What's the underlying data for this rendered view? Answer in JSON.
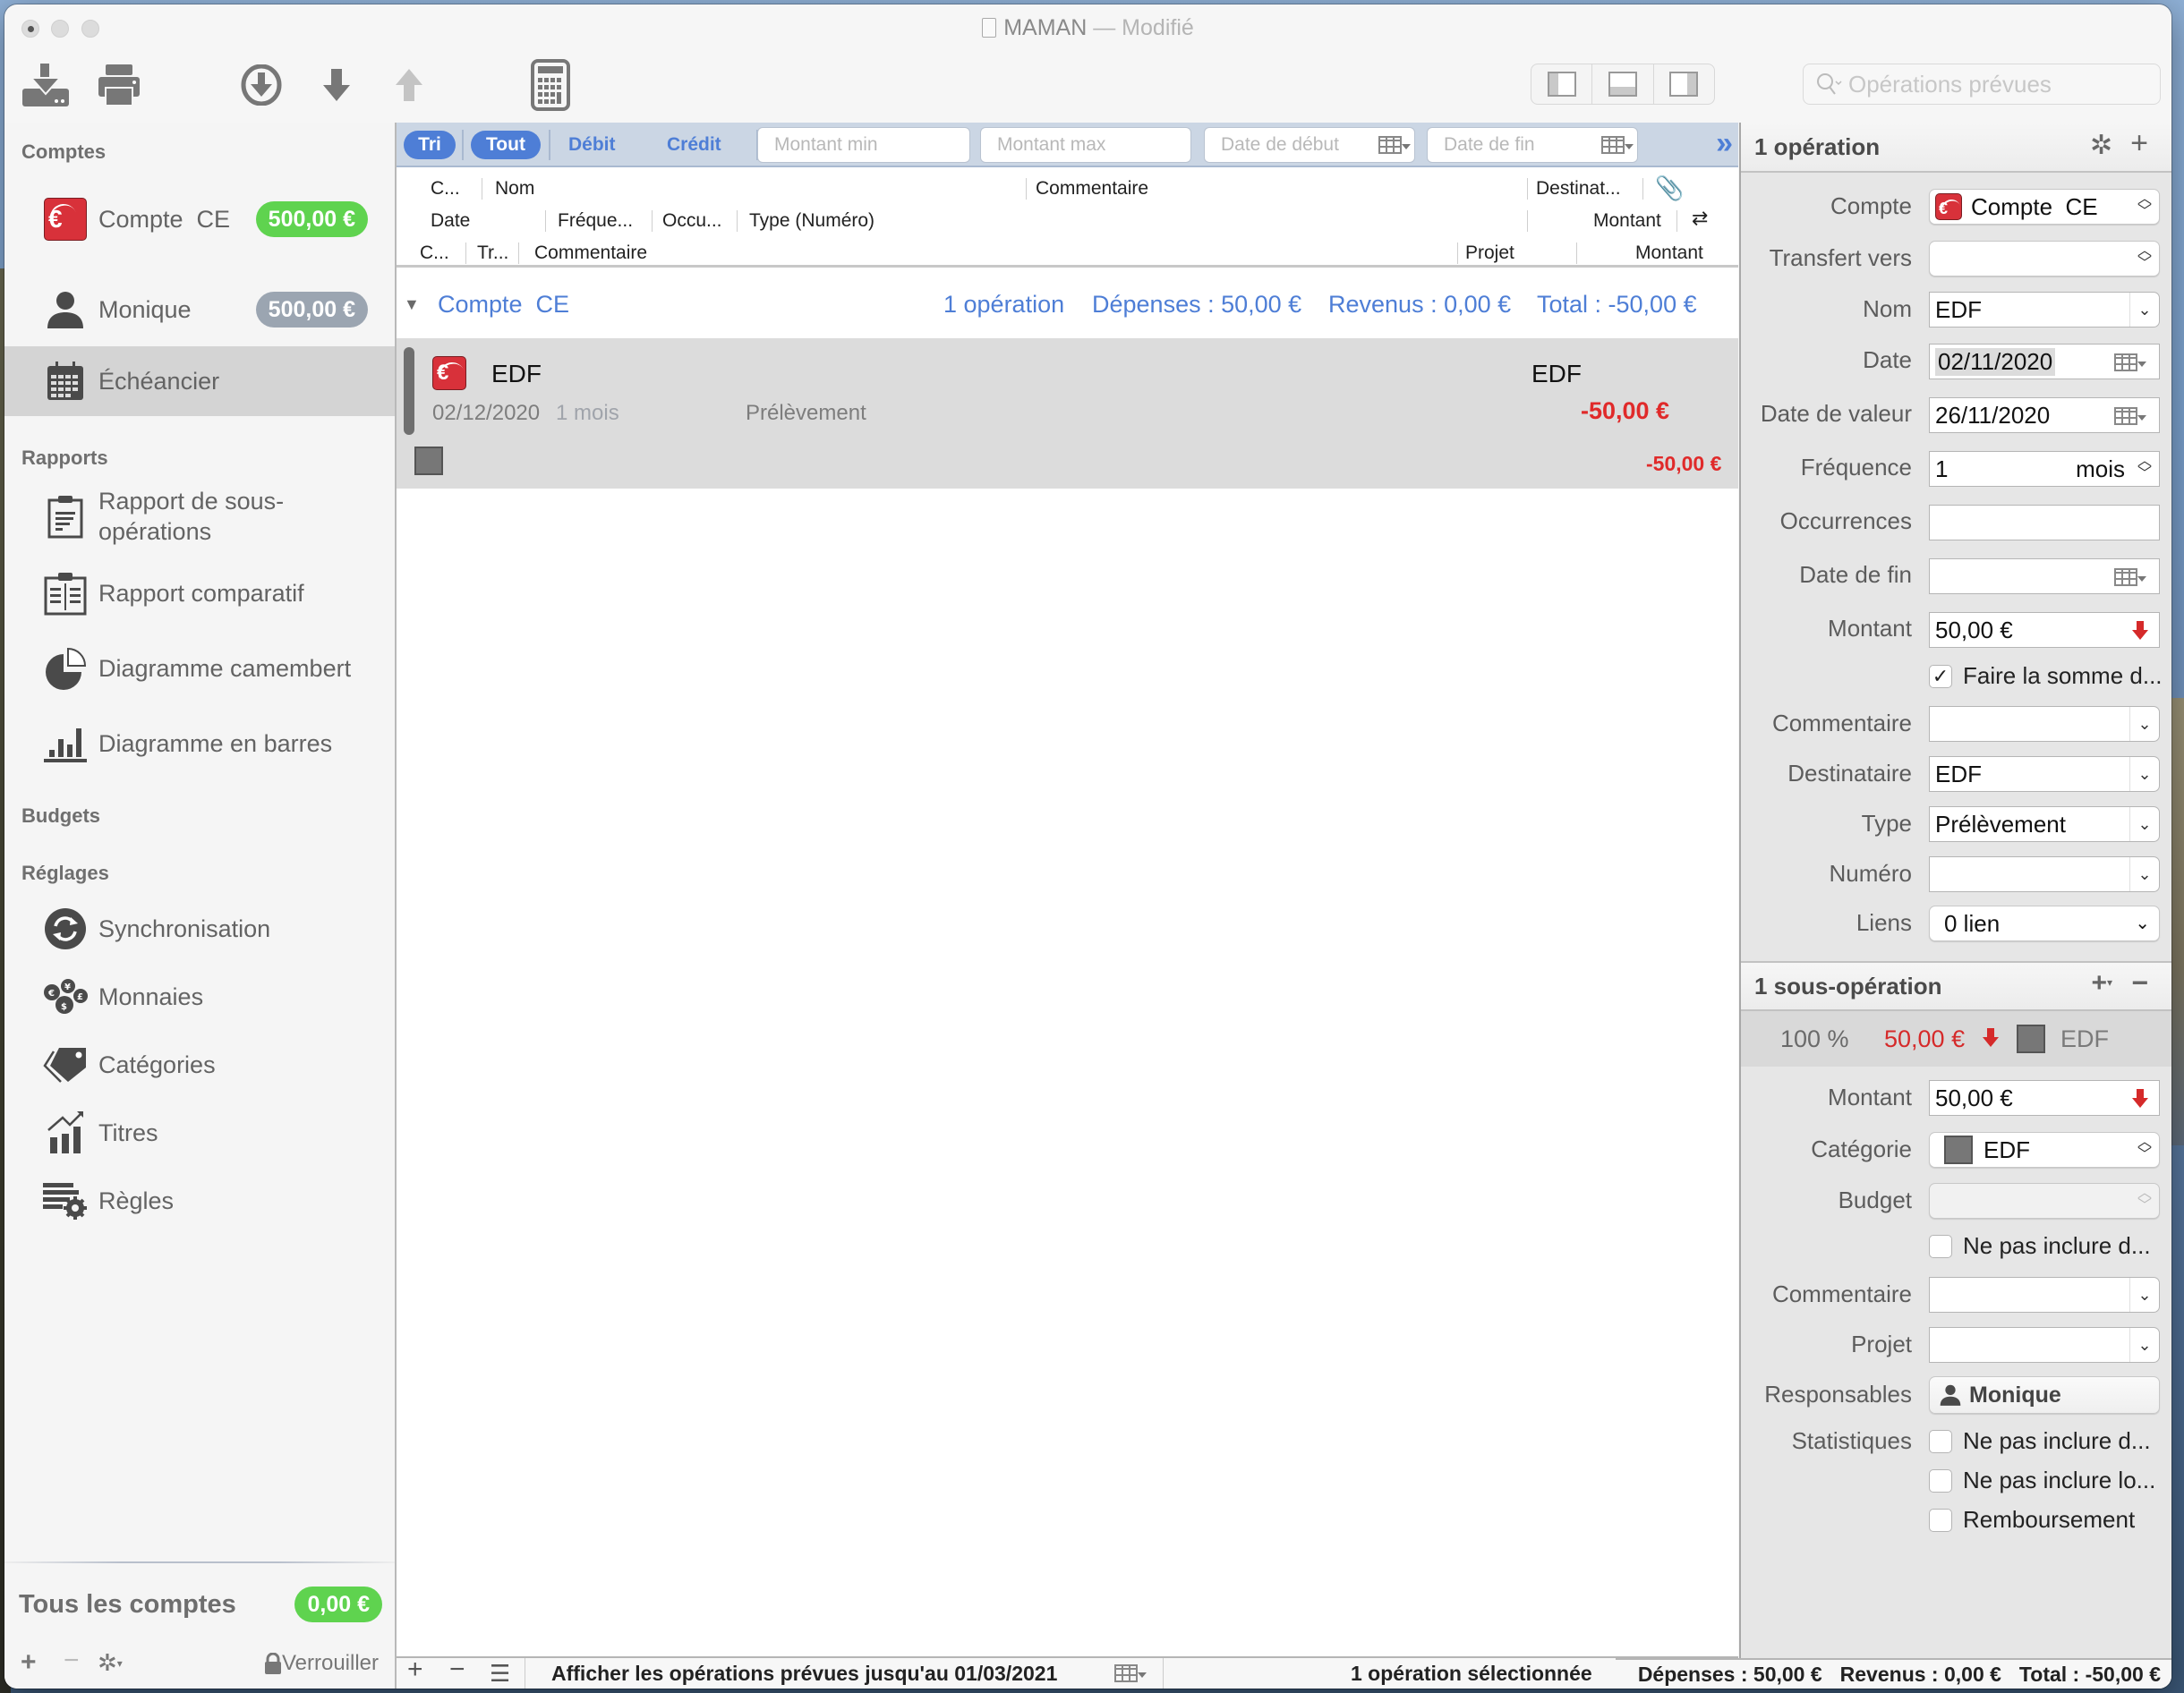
{
  "window": {
    "title": "MAMAN",
    "title_suffix": "— Modifié"
  },
  "toolbar": {
    "buttons": [
      {
        "name": "import-icon"
      },
      {
        "name": "print-icon"
      },
      {
        "name": "download-circle-icon"
      },
      {
        "name": "arrow-down-icon"
      },
      {
        "name": "arrow-up-icon"
      },
      {
        "name": "calculator-icon"
      }
    ],
    "view_toggles": [
      "sidebar-left-icon",
      "panel-bottom-icon",
      "sidebar-right-icon"
    ],
    "search_placeholder": "Opérations prévues"
  },
  "sidebar": {
    "sections": {
      "comptes": "Comptes",
      "rapports": "Rapports",
      "budgets": "Budgets",
      "reglages": "Réglages"
    },
    "accounts": [
      {
        "label": "Compte  CE",
        "balance": "500,00 €",
        "badge_color": "#5fd34f",
        "icon": "bank-icon"
      },
      {
        "label": "Monique",
        "balance": "500,00 €",
        "badge_color": "#9ba5b1",
        "icon": "person-icon"
      }
    ],
    "echeancier": "Échéancier",
    "reports": [
      {
        "label": "Rapport de sous-opérations",
        "icon": "clipboard-report-icon"
      },
      {
        "label": "Rapport comparatif",
        "icon": "clipboard-compare-icon"
      },
      {
        "label": "Diagramme camembert",
        "icon": "pie-chart-icon"
      },
      {
        "label": "Diagramme en barres",
        "icon": "bar-chart-icon"
      }
    ],
    "settings": [
      {
        "label": "Synchronisation",
        "icon": "sync-icon"
      },
      {
        "label": "Monnaies",
        "icon": "currencies-icon"
      },
      {
        "label": "Catégories",
        "icon": "tag-icon"
      },
      {
        "label": "Titres",
        "icon": "stocks-icon"
      },
      {
        "label": "Règles",
        "icon": "rules-icon"
      }
    ],
    "all_accounts_label": "Tous les comptes",
    "all_accounts_balance": "0,00 €",
    "lock_label": "Verrouiller"
  },
  "filter": {
    "tri": "Tri",
    "tout": "Tout",
    "debit": "Débit",
    "credit": "Crédit",
    "montant_min_placeholder": "Montant min",
    "montant_max_placeholder": "Montant max",
    "date_debut_placeholder": "Date de début",
    "date_fin_placeholder": "Date de fin"
  },
  "columns": {
    "row1": {
      "c": "C...",
      "nom": "Nom",
      "commentaire": "Commentaire",
      "destinataire": "Destinat..."
    },
    "row2": {
      "date": "Date",
      "frequence": "Fréque...",
      "occurrences": "Occu...",
      "type": "Type (Numéro)",
      "montant": "Montant"
    },
    "row3": {
      "c": "C...",
      "tr": "Tr...",
      "commentaire": "Commentaire",
      "projet": "Projet",
      "montant": "Montant"
    }
  },
  "group": {
    "name": "Compte  CE",
    "count": "1 opération",
    "depenses": "Dépenses : 50,00 €",
    "revenus": "Revenus : 0,00 €",
    "total": "Total : -50,00 €"
  },
  "operations": [
    {
      "nom": "EDF",
      "destinataire": "EDF",
      "date": "02/12/2020",
      "frequence": "1 mois",
      "type": "Prélèvement",
      "montant": "-50,00 €",
      "sub_montant": "-50,00 €"
    }
  ],
  "footer": {
    "show_until": "Afficher les opérations prévues jusqu'au 01/03/2021",
    "selection": "1 opération sélectionnée",
    "depenses": "Dépenses : 50,00 €",
    "revenus": "Revenus : 0,00 €",
    "total": "Total : -50,00 €"
  },
  "inspector": {
    "header": "1 opération",
    "fields": {
      "compte_label": "Compte",
      "compte_value": "Compte  CE",
      "transfert_label": "Transfert vers",
      "transfert_value": "",
      "nom_label": "Nom",
      "nom_value": "EDF",
      "date_label": "Date",
      "date_value": "02/11/2020",
      "date_valeur_label": "Date de valeur",
      "date_valeur_value": "26/11/2020",
      "frequence_label": "Fréquence",
      "frequence_value": "1",
      "frequence_unit": "mois",
      "occurrences_label": "Occurrences",
      "occurrences_value": "",
      "date_fin_label": "Date de fin",
      "date_fin_value": "",
      "montant_label": "Montant",
      "montant_value": "50,00 €",
      "somme_checkbox": "Faire la somme d...",
      "somme_checked": true,
      "commentaire_label": "Commentaire",
      "commentaire_value": "",
      "destinataire_label": "Destinataire",
      "destinataire_value": "EDF",
      "type_label": "Type",
      "type_value": "Prélèvement",
      "numero_label": "Numéro",
      "numero_value": "",
      "liens_label": "Liens",
      "liens_value": "0 lien"
    },
    "sub_header": "1 sous-opération",
    "sub_summary": {
      "percent": "100 %",
      "amount": "50,00 €",
      "category": "EDF"
    },
    "sub_fields": {
      "montant_label": "Montant",
      "montant_value": "50,00 €",
      "categorie_label": "Catégorie",
      "categorie_value": "EDF",
      "budget_label": "Budget",
      "budget_value": "",
      "exclude_budget": "Ne pas inclure d...",
      "commentaire_label": "Commentaire",
      "commentaire_value": "",
      "projet_label": "Projet",
      "projet_value": "",
      "responsables_label": "Responsables",
      "responsables_value": "Monique",
      "statistiques_label": "Statistiques",
      "stat_1": "Ne pas inclure d...",
      "stat_2": "Ne pas inclure lo...",
      "stat_3": "Remboursement"
    }
  },
  "colors": {
    "accent": "#4e7ed6",
    "expense_red": "#d52a2a",
    "badge_green": "#5fd34f",
    "badge_gray": "#9ba5b1"
  }
}
